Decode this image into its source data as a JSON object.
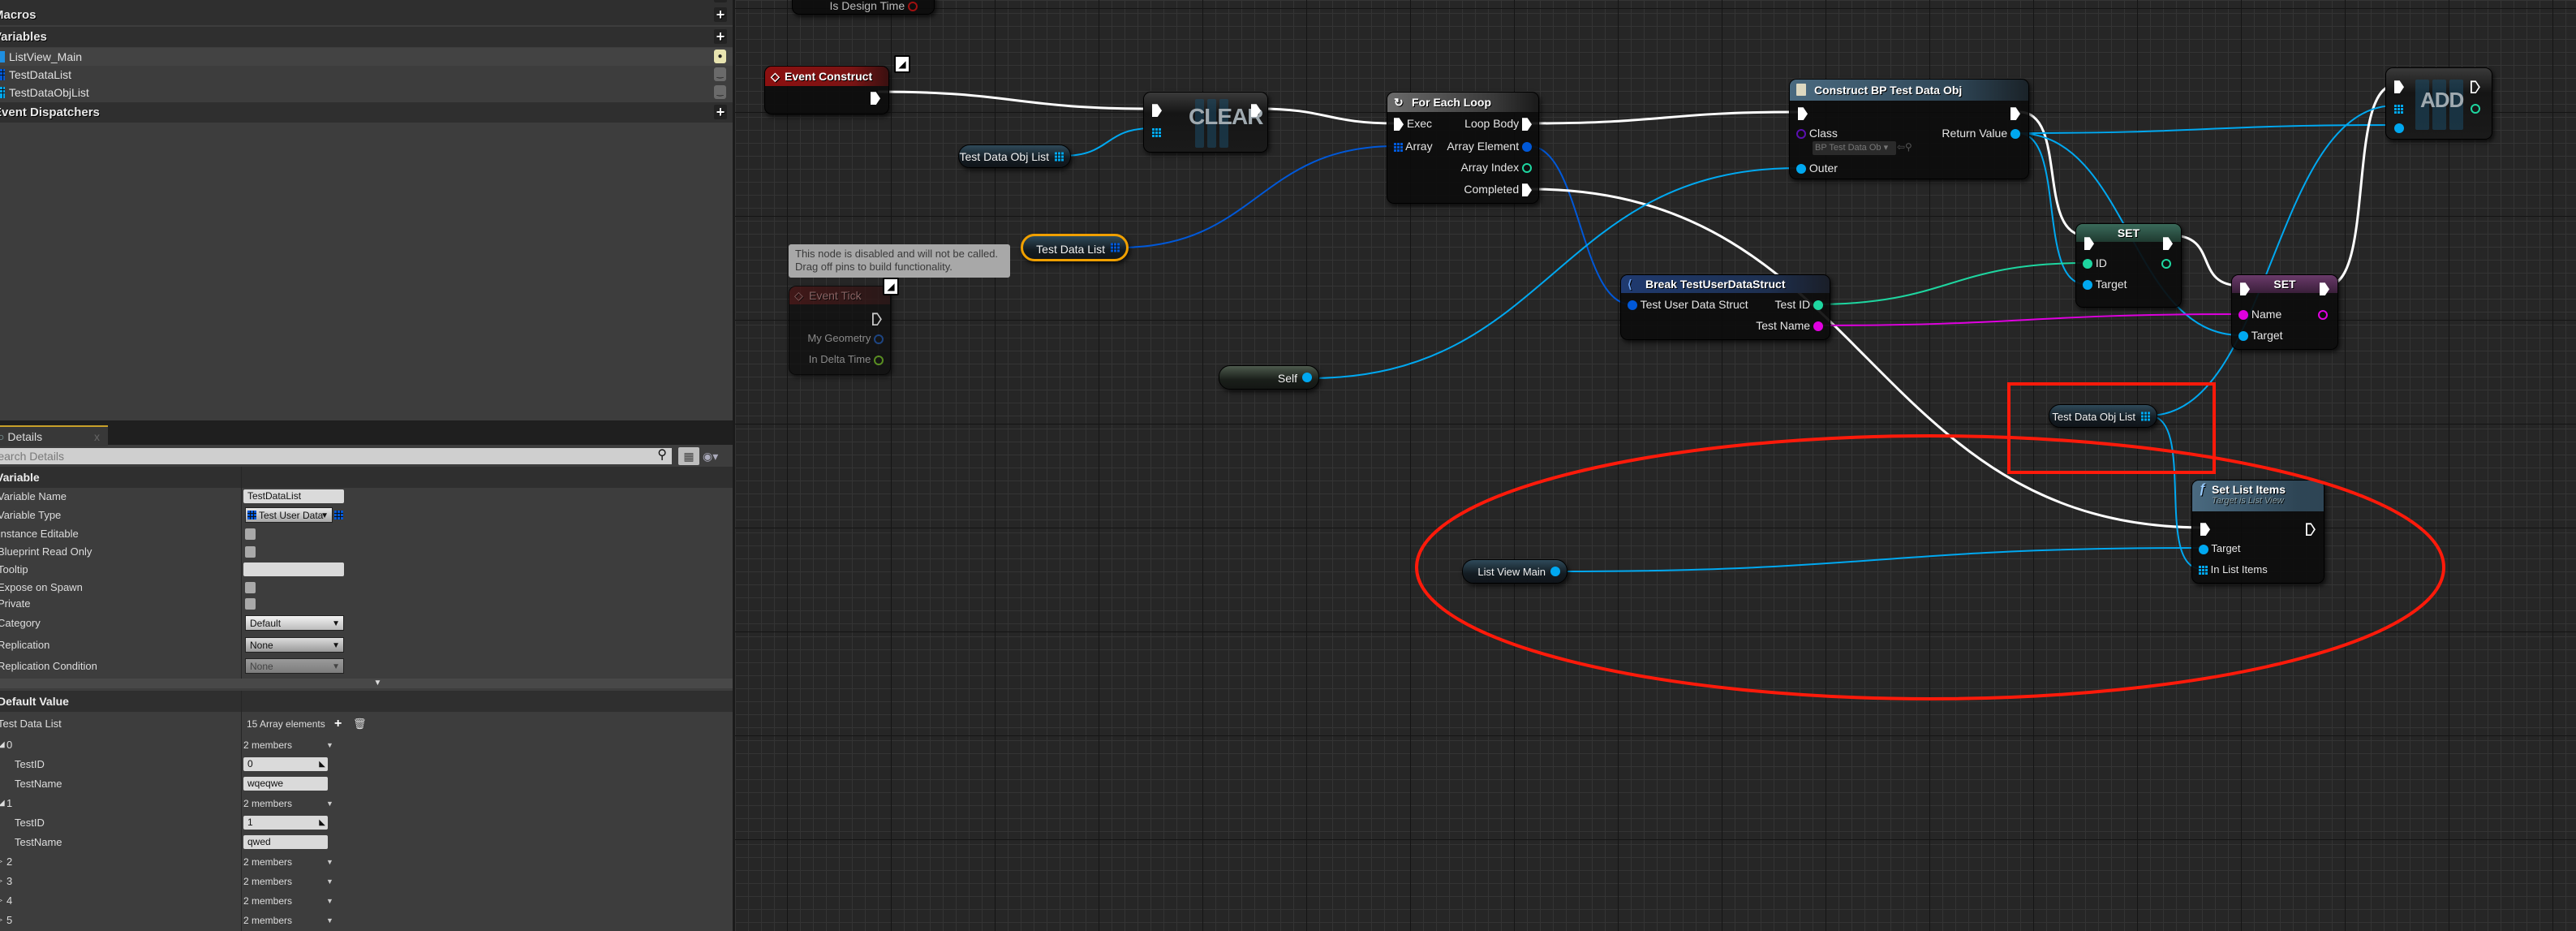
{
  "my_blueprint": {
    "sections": {
      "macros": "Macros",
      "variables": "Variables",
      "event_dispatchers": "Event Dispatchers"
    },
    "variables": [
      {
        "name": "ListView_Main",
        "type_color": "#1f8fe0",
        "visibility": "eye-open"
      },
      {
        "name": "TestDataList",
        "type_color": "#0058d8",
        "visibility": "eye-closed"
      },
      {
        "name": "TestDataObjList",
        "type_color": "#00a8f0",
        "visibility": "eye-closed"
      }
    ]
  },
  "details": {
    "tab_label": "Details",
    "tab_close": "x",
    "search_placeholder": "Search Details",
    "variable_section": "Variable",
    "variable_name_label": "Variable Name",
    "variable_name": "TestDataList",
    "variable_type_label": "Variable Type",
    "variable_type": "Test User Data",
    "instance_editable_label": "Instance Editable",
    "instance_editable": false,
    "read_only_label": "Blueprint Read Only",
    "read_only": false,
    "tooltip_label": "Tooltip",
    "tooltip": "",
    "expose_label": "Expose on Spawn",
    "expose": false,
    "private_label": "Private",
    "private": false,
    "category_label": "Category",
    "category": "Default",
    "replication_label": "Replication",
    "replication": "None",
    "replication_condition_label": "Replication Condition",
    "replication_condition": "None",
    "default_section": "Default Value",
    "array_label": "Test Data List",
    "array_count": "15 Array elements",
    "elements": [
      {
        "index": "0",
        "summary": "2 members",
        "expanded": true,
        "test_id_label": "TestID",
        "test_id": "0",
        "test_name_label": "TestName",
        "test_name": "wqeqwe"
      },
      {
        "index": "1",
        "summary": "2 members",
        "expanded": true,
        "test_id_label": "TestID",
        "test_id": "1",
        "test_name_label": "TestName",
        "test_name": "qwed"
      },
      {
        "index": "2",
        "summary": "2 members",
        "expanded": false
      },
      {
        "index": "3",
        "summary": "2 members",
        "expanded": false
      },
      {
        "index": "4",
        "summary": "2 members",
        "expanded": false
      },
      {
        "index": "5",
        "summary": "2 members",
        "expanded": false
      }
    ]
  },
  "graph": {
    "partial_node_pin": "Is Design Time",
    "event_construct": {
      "title": "Event Construct"
    },
    "clear": {
      "label": "CLEAR"
    },
    "getter_obj_list": "Test Data Obj List",
    "getter_data_list": "Test Data List",
    "comment": "This node is disabled and will not be called.\nDrag off pins to build functionality.",
    "event_tick": {
      "title": "Event Tick",
      "pins": [
        "My Geometry",
        "In Delta Time"
      ]
    },
    "self": "Self",
    "for_each": {
      "title": "For Each Loop",
      "exec": "Exec",
      "array": "Array",
      "loop_body": "Loop Body",
      "array_element": "Array Element",
      "array_index": "Array Index",
      "completed": "Completed"
    },
    "construct": {
      "title": "Construct BP Test Data Obj",
      "class": "Class",
      "class_value": "BP Test Data Ob",
      "outer": "Outer",
      "return_value": "Return Value"
    },
    "break_struct": {
      "title": "Break TestUserDataStruct",
      "input": "Test User Data Struct",
      "test_id": "Test ID",
      "test_name": "Test Name"
    },
    "set_id": {
      "title": "SET",
      "value": "ID",
      "target": "Target"
    },
    "set_name": {
      "title": "SET",
      "value": "Name",
      "target": "Target"
    },
    "add": {
      "label": "ADD"
    },
    "getter_obj_list_2": "Test Data Obj List",
    "set_list_items": {
      "title": "Set List Items",
      "subtitle": "Target is List View",
      "target": "Target",
      "items": "In List Items"
    },
    "list_view_main": "List View Main",
    "colors": {
      "exec": "#ffffff",
      "object": "#00a8f0",
      "struct": "#0058d8",
      "int": "#1ed6a0",
      "string": "#e000e0",
      "annotation": "#ff1a0a"
    }
  }
}
